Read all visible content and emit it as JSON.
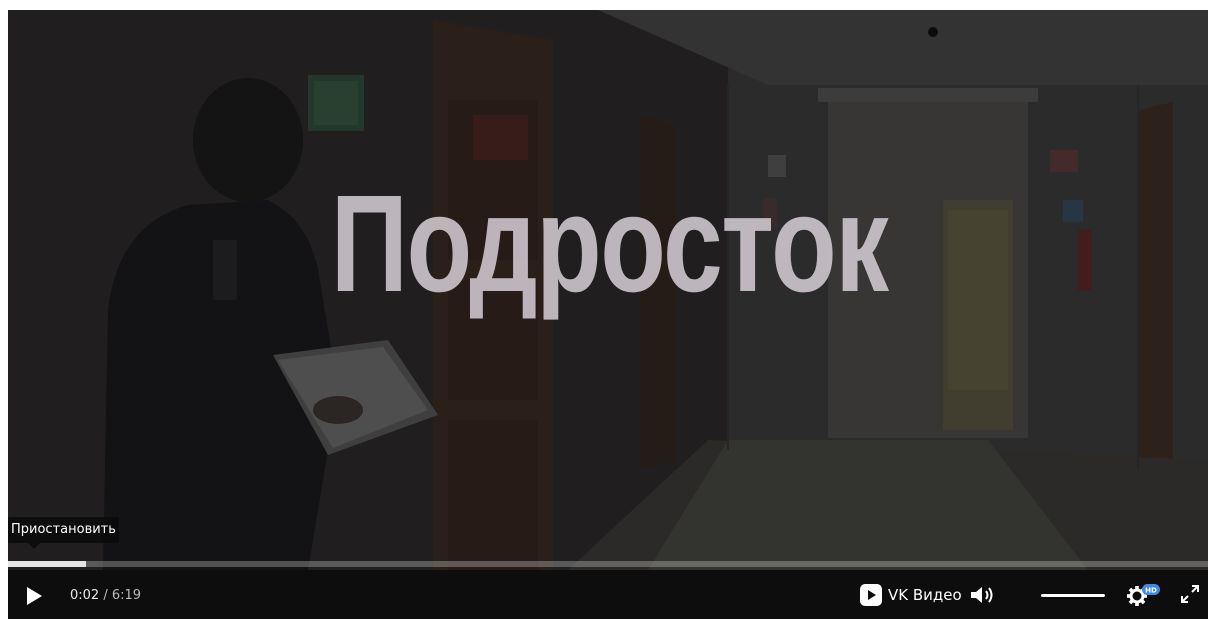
{
  "video": {
    "overlay_title": "Подросток"
  },
  "tooltip": {
    "text": "Приостановить"
  },
  "progress": {
    "played_fraction": 0.065
  },
  "controls": {
    "current_time": "0:02",
    "separator": " / ",
    "total_time": "6:19",
    "brand_label": "VK Видео",
    "quality_badge": "HD",
    "volume_level": 1.0,
    "icons": {
      "play": "play-icon",
      "brand": "vk-video-logo-icon",
      "volume": "volume-icon",
      "settings": "gear-icon",
      "fullscreen": "expand-icon"
    }
  },
  "colors": {
    "accent": "#3f8ae0",
    "control_bar": "#0d0d0d",
    "overlay_text": "#d6ced6"
  }
}
